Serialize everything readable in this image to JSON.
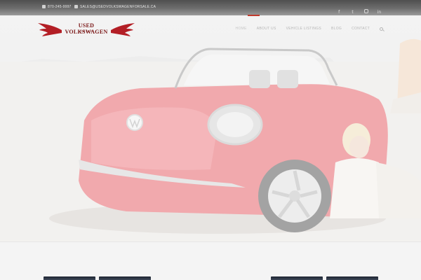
{
  "topbar": {
    "phone": "870-245-9997",
    "email": "SALES@USEDVOLKSWAGENFORSALE.CA",
    "social": [
      "facebook-icon",
      "twitter-icon",
      "instagram-icon",
      "linkedin-icon"
    ]
  },
  "logo": {
    "brand": "USED VOLKSWAGEN",
    "sub": "FOR SALE"
  },
  "nav": {
    "items": [
      "HOME",
      "ABOUT US",
      "VEHICLE LISTINGS",
      "BLOG",
      "CONTACT"
    ],
    "active": "HOME"
  },
  "colors": {
    "accent": "#c0392b",
    "topbar": "#6e6e6e",
    "car": "#e0606a"
  }
}
